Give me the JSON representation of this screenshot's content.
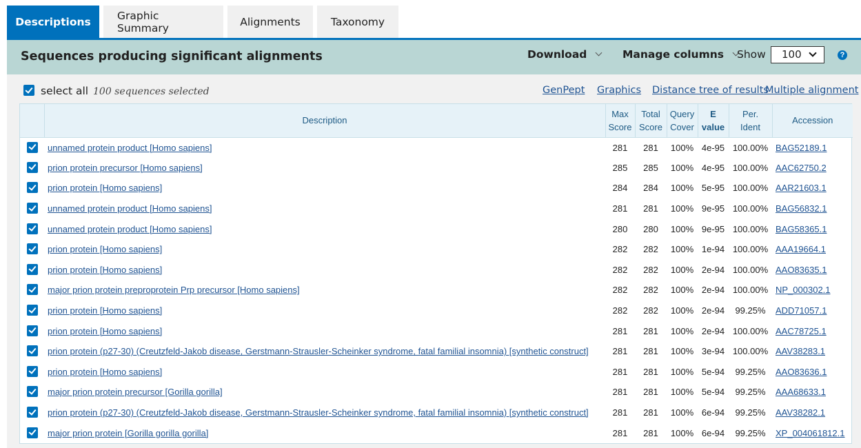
{
  "tabs": [
    {
      "label": "Descriptions",
      "active": true
    },
    {
      "label": "Graphic Summary",
      "active": false
    },
    {
      "label": "Alignments",
      "active": false
    },
    {
      "label": "Taxonomy",
      "active": false
    }
  ],
  "header": {
    "title": "Sequences producing significant alignments",
    "download": "Download",
    "manage_columns": "Manage columns",
    "show_label": "Show",
    "show_value": "100",
    "help_icon": "?"
  },
  "selection": {
    "select_all": "select all",
    "count_text": "100 sequences selected"
  },
  "links": {
    "genpept": "GenPept",
    "graphics": "Graphics",
    "distance_tree": "Distance tree of results",
    "multiple_alignment": "Multiple alignment"
  },
  "table": {
    "columns": {
      "description": "Description",
      "max_score": [
        "Max",
        "Score"
      ],
      "total_score": [
        "Total",
        "Score"
      ],
      "query_cover": [
        "Query",
        "Cover"
      ],
      "e_value": [
        "E",
        "value"
      ],
      "per_ident": [
        "Per.",
        "Ident"
      ],
      "accession": "Accession"
    },
    "rows": [
      {
        "desc": "unnamed protein product [Homo sapiens]",
        "max": "281",
        "total": "281",
        "cover": "100%",
        "evalue": "4e-95",
        "ident": "100.00%",
        "acc": "BAG52189.1"
      },
      {
        "desc": "prion protein precursor [Homo sapiens]",
        "max": "285",
        "total": "285",
        "cover": "100%",
        "evalue": "4e-95",
        "ident": "100.00%",
        "acc": "AAC62750.2"
      },
      {
        "desc": "prion protein [Homo sapiens]",
        "max": "284",
        "total": "284",
        "cover": "100%",
        "evalue": "5e-95",
        "ident": "100.00%",
        "acc": "AAR21603.1"
      },
      {
        "desc": "unnamed protein product [Homo sapiens]",
        "max": "281",
        "total": "281",
        "cover": "100%",
        "evalue": "9e-95",
        "ident": "100.00%",
        "acc": "BAG56832.1"
      },
      {
        "desc": "unnamed protein product [Homo sapiens]",
        "max": "280",
        "total": "280",
        "cover": "100%",
        "evalue": "9e-95",
        "ident": "100.00%",
        "acc": "BAG58365.1"
      },
      {
        "desc": "prion protein [Homo sapiens]",
        "max": "282",
        "total": "282",
        "cover": "100%",
        "evalue": "1e-94",
        "ident": "100.00%",
        "acc": "AAA19664.1"
      },
      {
        "desc": "prion protein [Homo sapiens]",
        "max": "282",
        "total": "282",
        "cover": "100%",
        "evalue": "2e-94",
        "ident": "100.00%",
        "acc": "AAO83635.1"
      },
      {
        "desc": "major prion protein preproprotein Prp precursor [Homo sapiens]",
        "max": "282",
        "total": "282",
        "cover": "100%",
        "evalue": "2e-94",
        "ident": "100.00%",
        "acc": "NP_000302.1"
      },
      {
        "desc": "prion protein [Homo sapiens]",
        "max": "282",
        "total": "282",
        "cover": "100%",
        "evalue": "2e-94",
        "ident": "99.25%",
        "acc": "ADD71057.1"
      },
      {
        "desc": "prion protein [Homo sapiens]",
        "max": "281",
        "total": "281",
        "cover": "100%",
        "evalue": "2e-94",
        "ident": "100.00%",
        "acc": "AAC78725.1"
      },
      {
        "desc": "prion protein (p27-30) (Creutzfeld-Jakob disease, Gerstmann-Strausler-Scheinker syndrome, fatal familial insomnia) [synthetic construct]",
        "max": "281",
        "total": "281",
        "cover": "100%",
        "evalue": "3e-94",
        "ident": "100.00%",
        "acc": "AAV38283.1"
      },
      {
        "desc": "prion protein [Homo sapiens]",
        "max": "281",
        "total": "281",
        "cover": "100%",
        "evalue": "5e-94",
        "ident": "99.25%",
        "acc": "AAO83636.1"
      },
      {
        "desc": "major prion protein precursor [Gorilla gorilla]",
        "max": "281",
        "total": "281",
        "cover": "100%",
        "evalue": "5e-94",
        "ident": "99.25%",
        "acc": "AAA68633.1"
      },
      {
        "desc": "prion protein (p27-30) (Creutzfeld-Jakob disease, Gerstmann-Strausler-Scheinker syndrome, fatal familial insomnia) [synthetic construct]",
        "max": "281",
        "total": "281",
        "cover": "100%",
        "evalue": "6e-94",
        "ident": "99.25%",
        "acc": "AAV38282.1"
      },
      {
        "desc": "major prion protein [Gorilla gorilla gorilla]",
        "max": "281",
        "total": "281",
        "cover": "100%",
        "evalue": "6e-94",
        "ident": "99.25%",
        "acc": "XP_004061812.1"
      }
    ]
  },
  "colors": {
    "accent": "#0071bc",
    "header_bg": "#b9d6d4",
    "link": "#205493",
    "table_header_bg": "#e6f2f8"
  }
}
